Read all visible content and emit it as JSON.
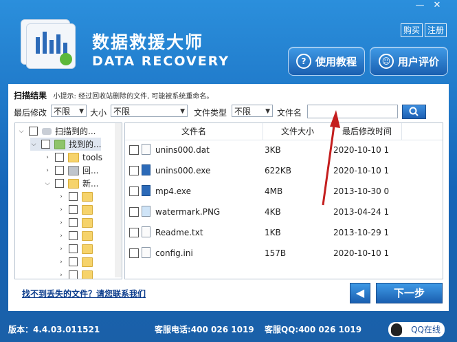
{
  "window": {
    "minimize": "—",
    "close": "✕",
    "accent_color": "#1e6fc0"
  },
  "header": {
    "title": "数据救援大师",
    "subtitle": "DATA RECOVERY",
    "buy": "购买",
    "register": "注册",
    "tutorial_btn": "使用教程",
    "review_btn": "用户评价"
  },
  "scan": {
    "result_label": "扫描结果",
    "hint": "小提示: 经过回收站删除的文件, 可能被系统重命名。"
  },
  "filters": {
    "modified_label": "最后修改",
    "modified_value": "不限",
    "size_label": "大小",
    "size_value": "不限",
    "type_label": "文件类型",
    "type_value": "不限",
    "name_label": "文件名",
    "name_value": ""
  },
  "tree": {
    "items": [
      {
        "label": "扫描到的..."
      },
      {
        "label": "找到的..."
      },
      {
        "label": "tools"
      },
      {
        "label": "回..."
      },
      {
        "label": "新..."
      }
    ]
  },
  "list": {
    "columns": [
      "文件名",
      "文件大小",
      "最后修改时间"
    ],
    "rows": [
      {
        "name": "unins000.dat",
        "size": "3KB",
        "date": "2020-10-10 1"
      },
      {
        "name": "unins000.exe",
        "size": "622KB",
        "date": "2020-10-10 1"
      },
      {
        "name": "mp4.exe",
        "size": "4MB",
        "date": "2013-10-30 0"
      },
      {
        "name": "watermark.PNG",
        "size": "4KB",
        "date": "2013-04-24 1"
      },
      {
        "name": "Readme.txt",
        "size": "1KB",
        "date": "2013-10-29 1"
      },
      {
        "name": "config.ini",
        "size": "157B",
        "date": "2020-10-10 1"
      }
    ]
  },
  "bottom": {
    "help_link": "找不到丢失的文件？请您联系我们",
    "next": "下一步",
    "back_icon": "◀"
  },
  "footer": {
    "version": "版本：4.4.03.011521",
    "phone": "客服电话:400 026 1019",
    "qq": "客服QQ:400 026 1019",
    "qq_online": "QQ在线"
  }
}
